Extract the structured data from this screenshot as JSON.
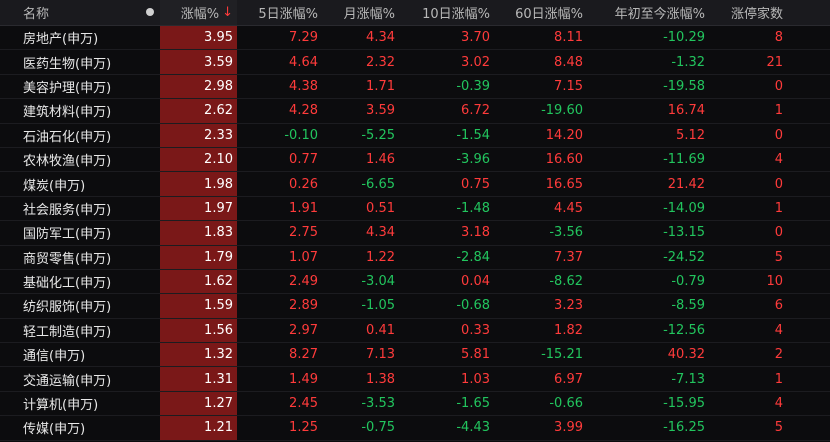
{
  "header": {
    "name": "名称",
    "dot_icon": "dot-icon",
    "pct": "涨幅%",
    "sort_icon": "arrow-down-icon",
    "sort_arrow": "↓",
    "d5": "5日涨幅%",
    "month": "月涨幅%",
    "d10": "10日涨幅%",
    "d60": "60日涨幅%",
    "ytd": "年初至今涨幅%",
    "limit": "涨停家数"
  },
  "colors": {
    "up": "#ff3b3b",
    "down": "#22c55e",
    "highlight": "#7a1818"
  },
  "rows": [
    {
      "name": "房地产(申万)",
      "pct": "3.95",
      "d5": "7.29",
      "month": "4.34",
      "d10": "3.70",
      "d60": "8.11",
      "ytd": "-10.29",
      "limit": "8"
    },
    {
      "name": "医药生物(申万)",
      "pct": "3.59",
      "d5": "4.64",
      "month": "2.32",
      "d10": "3.02",
      "d60": "8.48",
      "ytd": "-1.32",
      "limit": "21"
    },
    {
      "name": "美容护理(申万)",
      "pct": "2.98",
      "d5": "4.38",
      "month": "1.71",
      "d10": "-0.39",
      "d60": "7.15",
      "ytd": "-19.58",
      "limit": "0"
    },
    {
      "name": "建筑材料(申万)",
      "pct": "2.62",
      "d5": "4.28",
      "month": "3.59",
      "d10": "6.72",
      "d60": "-19.60",
      "ytd": "16.74",
      "limit": "1"
    },
    {
      "name": "石油石化(申万)",
      "pct": "2.33",
      "d5": "-0.10",
      "month": "-5.25",
      "d10": "-1.54",
      "d60": "14.20",
      "ytd": "5.12",
      "limit": "0"
    },
    {
      "name": "农林牧渔(申万)",
      "pct": "2.10",
      "d5": "0.77",
      "month": "1.46",
      "d10": "-3.96",
      "d60": "16.60",
      "ytd": "-11.69",
      "limit": "4"
    },
    {
      "name": "煤炭(申万)",
      "pct": "1.98",
      "d5": "0.26",
      "month": "-6.65",
      "d10": "0.75",
      "d60": "16.65",
      "ytd": "21.42",
      "limit": "0"
    },
    {
      "name": "社会服务(申万)",
      "pct": "1.97",
      "d5": "1.91",
      "month": "0.51",
      "d10": "-1.48",
      "d60": "4.45",
      "ytd": "-14.09",
      "limit": "1"
    },
    {
      "name": "国防军工(申万)",
      "pct": "1.83",
      "d5": "2.75",
      "month": "4.34",
      "d10": "3.18",
      "d60": "-3.56",
      "ytd": "-13.15",
      "limit": "0"
    },
    {
      "name": "商贸零售(申万)",
      "pct": "1.79",
      "d5": "1.07",
      "month": "1.22",
      "d10": "-2.84",
      "d60": "7.37",
      "ytd": "-24.52",
      "limit": "5"
    },
    {
      "name": "基础化工(申万)",
      "pct": "1.62",
      "d5": "2.49",
      "month": "-3.04",
      "d10": "0.04",
      "d60": "-8.62",
      "ytd": "-0.79",
      "limit": "10"
    },
    {
      "name": "纺织服饰(申万)",
      "pct": "1.59",
      "d5": "2.89",
      "month": "-1.05",
      "d10": "-0.68",
      "d60": "3.23",
      "ytd": "-8.59",
      "limit": "6"
    },
    {
      "name": "轻工制造(申万)",
      "pct": "1.56",
      "d5": "2.97",
      "month": "0.41",
      "d10": "0.33",
      "d60": "1.82",
      "ytd": "-12.56",
      "limit": "4"
    },
    {
      "name": "通信(申万)",
      "pct": "1.32",
      "d5": "8.27",
      "month": "7.13",
      "d10": "5.81",
      "d60": "-15.21",
      "ytd": "40.32",
      "limit": "2"
    },
    {
      "name": "交通运输(申万)",
      "pct": "1.31",
      "d5": "1.49",
      "month": "1.38",
      "d10": "1.03",
      "d60": "6.97",
      "ytd": "-7.13",
      "limit": "1"
    },
    {
      "name": "计算机(申万)",
      "pct": "1.27",
      "d5": "2.45",
      "month": "-3.53",
      "d10": "-1.65",
      "d60": "-0.66",
      "ytd": "-15.95",
      "limit": "4"
    },
    {
      "name": "传媒(申万)",
      "pct": "1.21",
      "d5": "1.25",
      "month": "-0.75",
      "d10": "-4.43",
      "d60": "3.99",
      "ytd": "-16.25",
      "limit": "5"
    }
  ]
}
